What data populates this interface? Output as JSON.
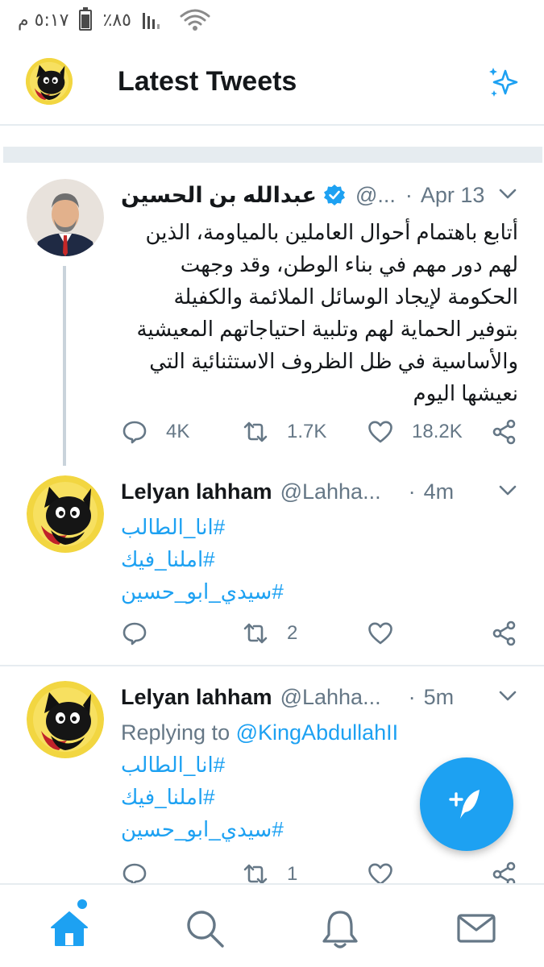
{
  "status_bar": {
    "time": "٥:١٧ م",
    "battery": "٪٨٥"
  },
  "header": {
    "title": "Latest Tweets"
  },
  "colors": {
    "accent": "#1da1f2",
    "secondary_text": "#657786",
    "divider": "#e6ecf0"
  },
  "tweets": [
    {
      "name": "عبدالله بن الحسين",
      "verified": true,
      "handle": "@...",
      "time": "Apr 13",
      "text": "أتابع باهتمام أحوال العاملين بالمياومة، الذين لهم دور مهم في بناء الوطن، وقد وجهت الحكومة لإيجاد الوسائل الملائمة والكفيلة بتوفير الحماية لهم وتلبية احتياجاتهم المعيشية والأساسية في ظل الظروف الاستثنائية التي نعيشها اليوم",
      "replies": "4K",
      "retweets": "1.7K",
      "likes": "18.2K"
    },
    {
      "name": "Lelyan lahham",
      "handle": "@Lahha...",
      "time": "4m",
      "hashtags": [
        "#انا_الطالب",
        "#املنا_فيك",
        "#سيدي_ابو_حسين"
      ],
      "retweets": "2"
    },
    {
      "name": "Lelyan lahham",
      "handle": "@Lahha...",
      "time": "5m",
      "replying_prefix": "Replying to",
      "replying_to": "@KingAbdullahII",
      "hashtags": [
        "#انا_الطالب",
        "#املنا_فيك",
        "#سيدي_ابو_حسين"
      ],
      "retweets": "1"
    }
  ],
  "icons": {
    "header": [
      "cat-avatar",
      "sparkle-icon"
    ],
    "tweet_actions": [
      "reply-icon",
      "retweet-icon",
      "like-icon",
      "share-icon"
    ],
    "fab": "compose-tweet-icon",
    "bottom_nav": [
      "home-icon",
      "search-icon",
      "notifications-icon",
      "messages-icon"
    ]
  }
}
